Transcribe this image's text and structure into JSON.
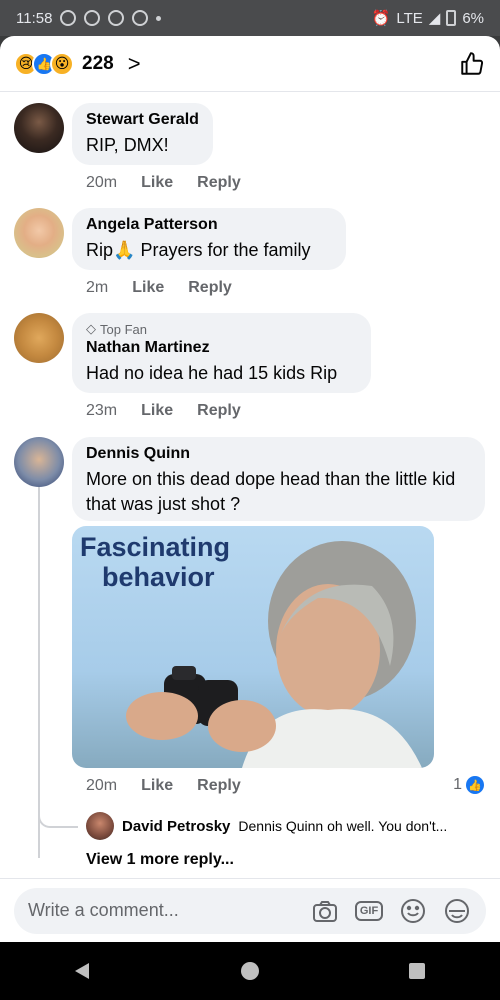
{
  "status_bar": {
    "time": "11:58",
    "network": "LTE",
    "battery": "6%"
  },
  "reactions": {
    "count": "228",
    "chevron": ">",
    "types": [
      "sad",
      "like",
      "wow"
    ]
  },
  "comments": [
    {
      "author": "Stewart Gerald",
      "text": "RIP, DMX!",
      "time": "20m",
      "like": "Like",
      "reply": "Reply"
    },
    {
      "author": "Angela Patterson",
      "text_before": "Rip",
      "emoji": "🙏",
      "text_after": " Prayers for the family",
      "time": "2m",
      "like": "Like",
      "reply": "Reply"
    },
    {
      "badge": "Top Fan",
      "author": "Nathan Martinez",
      "text": "Had no idea he had 15 kids Rip",
      "time": "23m",
      "like": "Like",
      "reply": "Reply"
    },
    {
      "author": "Dennis Quinn",
      "text": "More on this dead dope head than the little kid that was just shot ?",
      "gif_caption_line1": "Fascinating",
      "gif_caption_line2": "behavior",
      "time": "20m",
      "like": "Like",
      "reply": "Reply",
      "like_count": "1"
    }
  ],
  "reply": {
    "author": "David Petrosky",
    "text": "Dennis Quinn oh well. You don't...",
    "view_more": "View 1 more reply..."
  },
  "composer": {
    "placeholder": "Write a comment...",
    "gif_label": "GIF"
  }
}
